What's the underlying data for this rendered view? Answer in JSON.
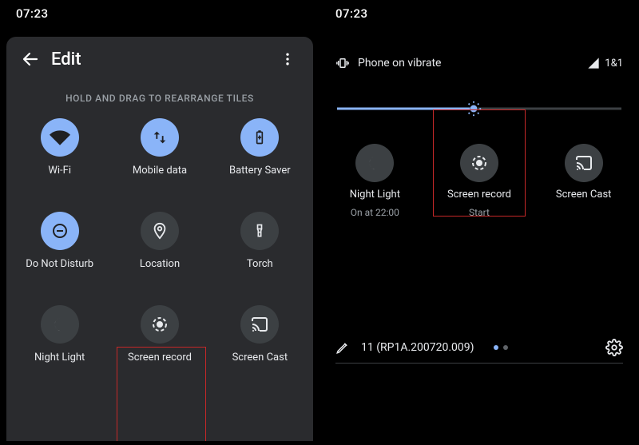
{
  "left": {
    "status_time": "07:23",
    "header": {
      "title": "Edit"
    },
    "instruction": "HOLD AND DRAG TO REARRANGE TILES",
    "tiles": [
      {
        "label": "Wi-Fi",
        "icon": "wifi-icon",
        "active": true
      },
      {
        "label": "Mobile data",
        "icon": "mobiledata-icon",
        "active": true
      },
      {
        "label": "Battery Saver",
        "icon": "battery-icon",
        "active": true
      },
      {
        "label": "Do Not Disturb",
        "icon": "dnd-icon",
        "active": true
      },
      {
        "label": "Location",
        "icon": "location-icon",
        "active": false
      },
      {
        "label": "Torch",
        "icon": "torch-icon",
        "active": false
      },
      {
        "label": "Night Light",
        "icon": "nightlight-icon",
        "active": false
      },
      {
        "label": "Screen record",
        "icon": "screenrecord-icon",
        "active": false
      },
      {
        "label": "Screen Cast",
        "icon": "cast-icon",
        "active": false
      }
    ]
  },
  "right": {
    "status_time": "07:23",
    "ringer_label": "Phone on vibrate",
    "signal_label": "1&1",
    "tiles": [
      {
        "label": "Night Light",
        "sub": "On at 22:00",
        "icon": "nightlight-icon"
      },
      {
        "label": "Screen record",
        "sub": "Start",
        "icon": "screenrecord-icon"
      },
      {
        "label": "Screen Cast",
        "sub": "",
        "icon": "cast-icon"
      }
    ],
    "build_text": "11 (RP1A.200720.009)"
  },
  "colors": {
    "accent": "#8ab4f8",
    "panel": "#2a2b2e",
    "circ_inactive": "#3c4043",
    "highlight": "#c62828"
  }
}
